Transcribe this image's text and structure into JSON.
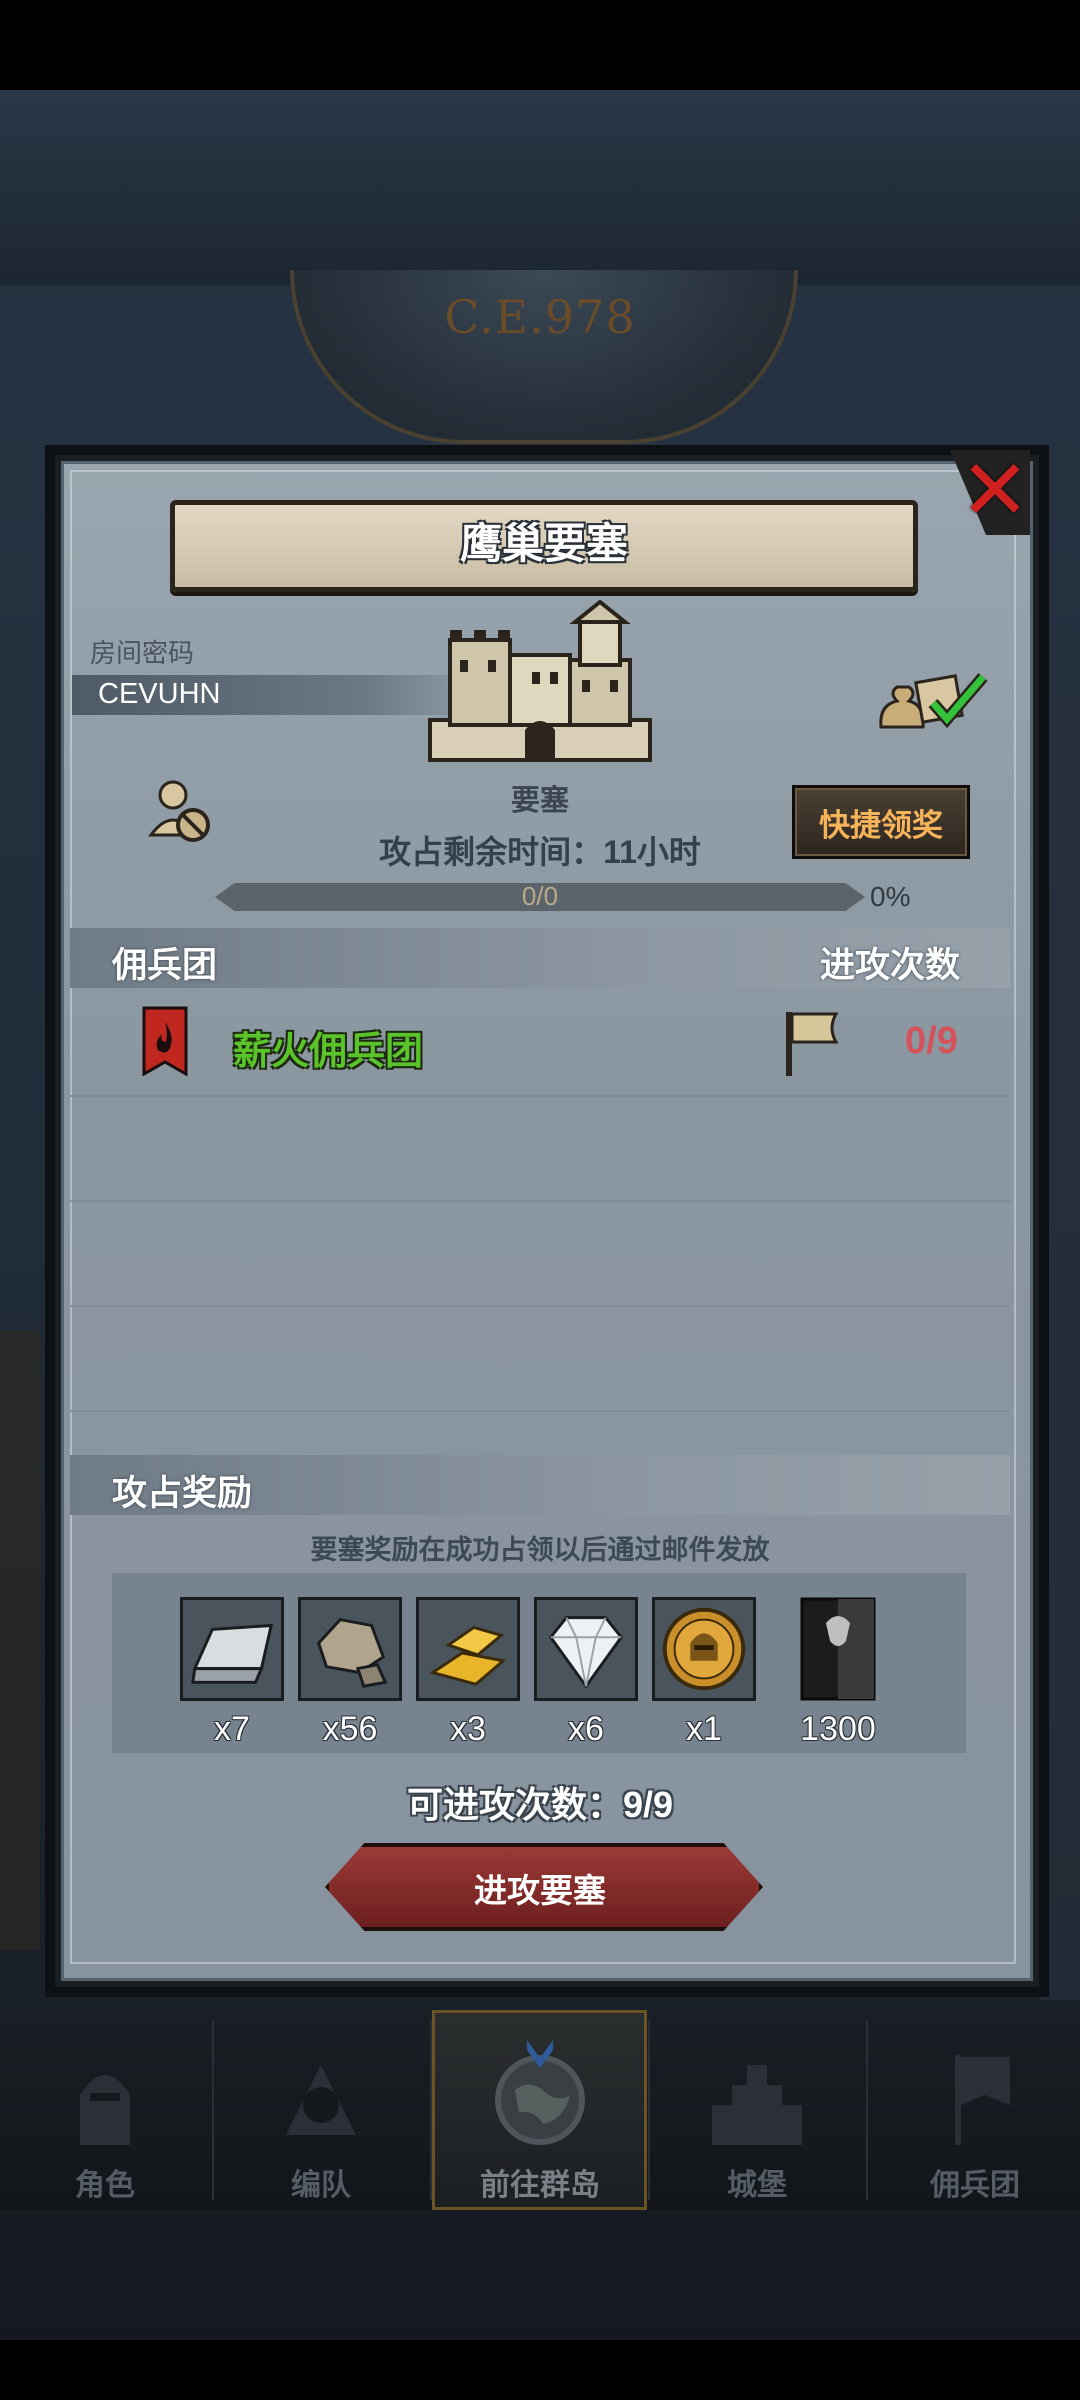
{
  "background": {
    "era": "C.E.978"
  },
  "dialog": {
    "title": "鹰巢要塞",
    "room_password_label": "房间密码",
    "room_password": "CEVUHN",
    "building_label": "要塞",
    "time_remaining": "攻占剩余时间：11小时",
    "quick_claim_label": "快捷领奖",
    "progress": {
      "text": "0/0",
      "percent_text": "0%",
      "value": 0
    },
    "mercenary_header": "佣兵团",
    "attack_count_header": "进攻次数",
    "mercenaries": [
      {
        "name": "薪火佣兵团",
        "attacks": "0/9"
      }
    ],
    "rewards_header": "攻占奖励",
    "rewards_note": "要塞奖励在成功占领以后通过邮件发放",
    "rewards": [
      {
        "icon": "silver-ingot-icon",
        "count": "x7"
      },
      {
        "icon": "stone-ore-icon",
        "count": "x56"
      },
      {
        "icon": "gold-bars-icon",
        "count": "x3"
      },
      {
        "icon": "diamond-icon",
        "count": "x6"
      },
      {
        "icon": "knight-medal-icon",
        "count": "x1"
      },
      {
        "icon": "guild-banner-icon",
        "count": "1300"
      }
    ],
    "attempts": "可进攻次数：9/9",
    "attack_button": "进攻要塞"
  },
  "nav": [
    {
      "label": "角色",
      "icon": "knight-icon"
    },
    {
      "label": "编队",
      "icon": "formation-icon"
    },
    {
      "label": "前往群岛",
      "icon": "globe-icon",
      "active": true
    },
    {
      "label": "城堡",
      "icon": "castle-icon"
    },
    {
      "label": "佣兵团",
      "icon": "mercenary-icon"
    }
  ],
  "colors": {
    "panel": "#9aa6af",
    "accent_green": "#5bc42a",
    "attack_count_red": "#d4535a",
    "quick_claim_orange": "#f5b35a",
    "attack_button_red": "#8a2f2c"
  }
}
